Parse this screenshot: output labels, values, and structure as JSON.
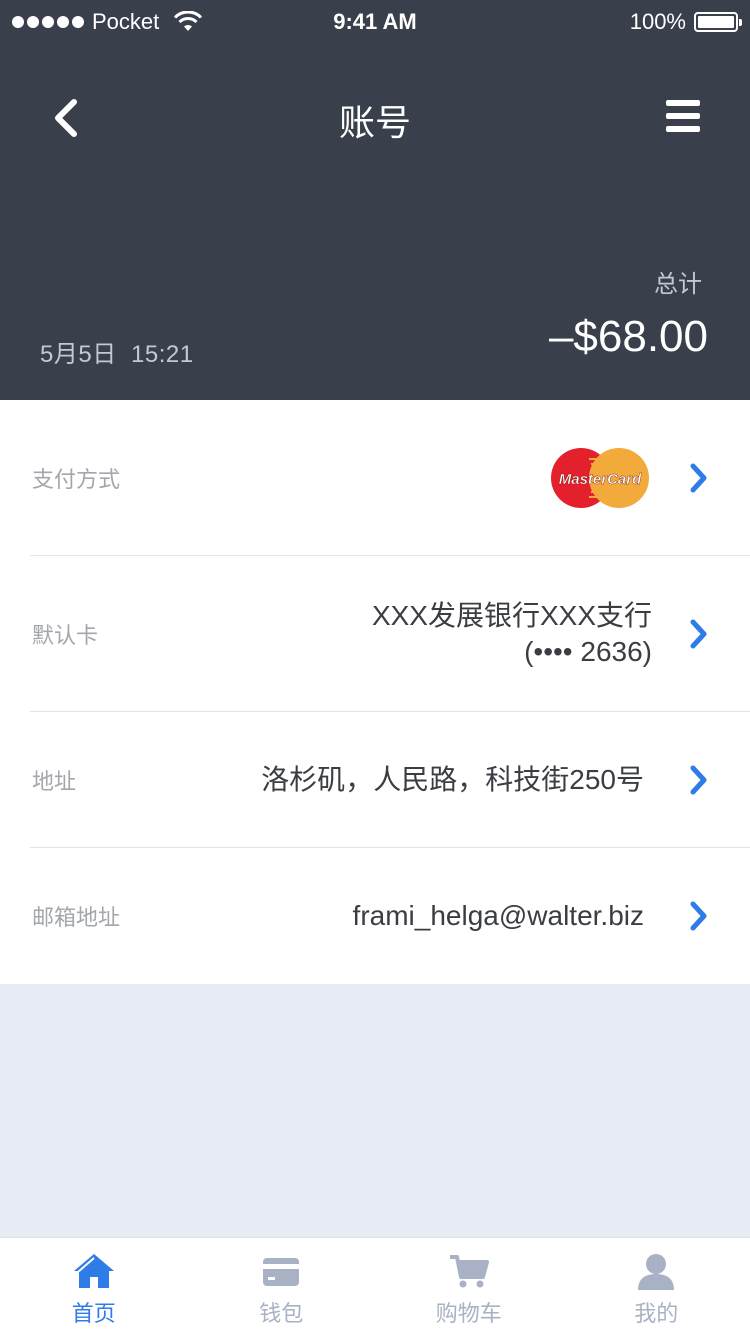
{
  "status_bar": {
    "carrier": "Pocket",
    "time": "9:41 AM",
    "battery": "100%"
  },
  "nav": {
    "title": "账号",
    "back_icon": "chevron-left-icon",
    "menu_icon": "hamburger-menu-icon"
  },
  "summary": {
    "total_label": "总计",
    "date": "5月5日  15:21",
    "amount": "–$68.00"
  },
  "rows": [
    {
      "label": "支付方式",
      "value": "",
      "brand": "MasterCard"
    },
    {
      "label": "默认卡",
      "value_line1": "XXX发展银行XXX支行",
      "value_line2": "(•••• 2636)"
    },
    {
      "label": "地址",
      "value": "洛杉矶，人民路，科技街250号"
    },
    {
      "label": "邮箱地址",
      "value": "frami_helga@walter.biz"
    }
  ],
  "tabs": [
    {
      "label": "首页",
      "icon": "home-icon",
      "active": true
    },
    {
      "label": "钱包",
      "icon": "wallet-card-icon",
      "active": false
    },
    {
      "label": "购物车",
      "icon": "cart-icon",
      "active": false
    },
    {
      "label": "我的",
      "icon": "user-icon",
      "active": false
    }
  ],
  "colors": {
    "header_bg": "#393f4b",
    "accent": "#2f7ce9",
    "page_bg": "#e8ecf4",
    "tab_inactive": "#a9b1c4"
  }
}
